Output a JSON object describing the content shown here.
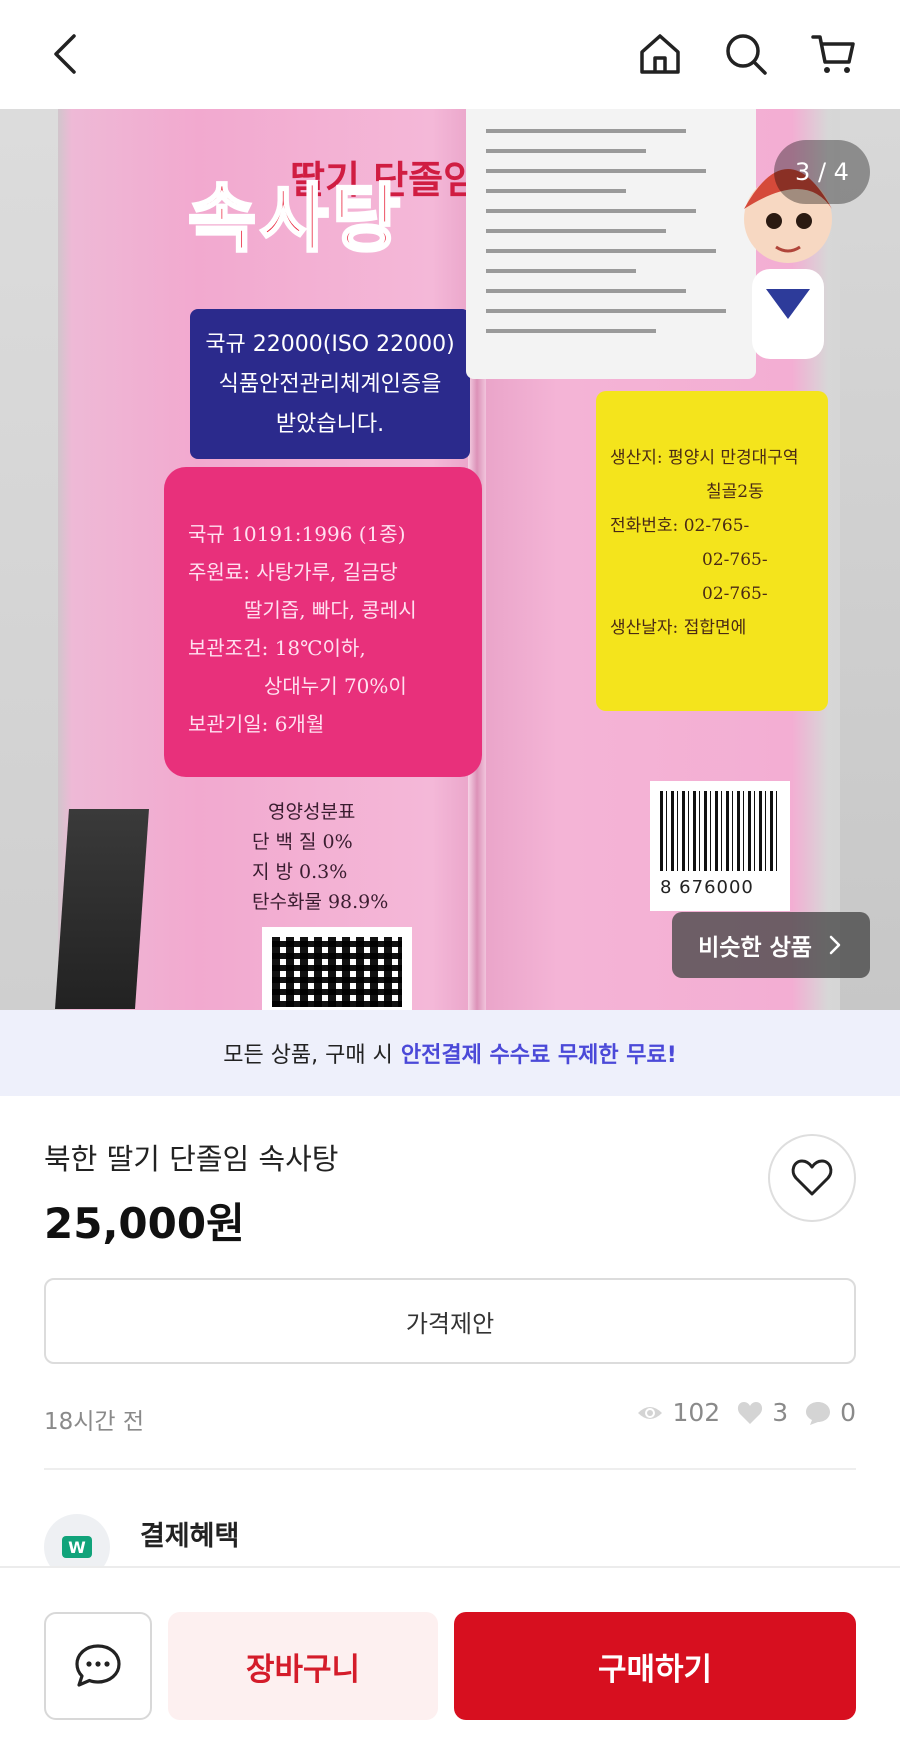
{
  "header": {
    "icons": [
      "back-arrow-icon",
      "home-icon",
      "search-icon",
      "cart-icon"
    ]
  },
  "gallery": {
    "counter": "3 / 4",
    "current_index": 3,
    "total": 4,
    "similar_button": "비슷한 상품",
    "package_text": {
      "title": "속사탕",
      "subtitle": "딸기 단졸임",
      "certification": [
        "국규 22000(ISO 22000)",
        "식품안전관리체계인증을",
        "받았습니다."
      ],
      "specs": [
        "국규 10191:1996 (1종)",
        "주원료: 사탕가루, 길금당",
        "딸기즙, 빠다, 콩레시",
        "보관조건: 18℃이하,",
        "상대누기 70%이",
        "보관기일: 6개월"
      ],
      "nutrition": [
        "영양성분표",
        "단 백 질   0%",
        "지    방   0.3%",
        "탄수화물   98.9%"
      ],
      "origin": [
        "생산지: 평양시 만경대구역",
        "칠골2동",
        "전화번호: 02-765-",
        "02-765-",
        "02-765-",
        "생산날자: 접합면에"
      ],
      "barcode": "8 676000"
    }
  },
  "promo": {
    "prefix": "모든 상품, 구매 시",
    "highlight": "안전결제 수수료 무제한 무료!"
  },
  "product": {
    "title": "북한 딸기 단졸임 속사탕",
    "price": "25,000원",
    "offer_button": "가격제안",
    "time_ago": "18시간 전",
    "views": "102",
    "likes": "3",
    "chats": "0"
  },
  "benefit": {
    "logo": "W",
    "title": "결제혜택"
  },
  "bottom": {
    "cart_label": "장바구니",
    "buy_label": "구매하기"
  },
  "colors": {
    "brand_red": "#d70f1f",
    "promo_accent": "#4b49d8",
    "promo_bg": "#eef0fb"
  }
}
